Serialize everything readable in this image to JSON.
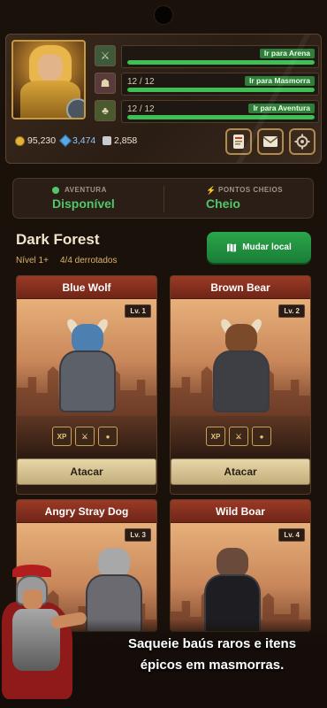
{
  "profile": {
    "quests": [
      {
        "icon": "arena-icon",
        "count": "",
        "link": "Ir para Arena",
        "fill": 1.0
      },
      {
        "icon": "dungeon-icon",
        "count": "12 / 12",
        "link": "Ir para Masmorra",
        "fill": 1.0
      },
      {
        "icon": "adventure-icon",
        "count": "12 / 12",
        "link": "Ir para Aventura",
        "fill": 1.0
      }
    ],
    "gold": "95,230",
    "gems": "3,474",
    "tokens": "2,858"
  },
  "status": {
    "adventure_label": "AVENTURA",
    "adventure_value": "Disponível",
    "points_label": "PONTOS CHEIOS",
    "points_value": "Cheio"
  },
  "location": {
    "title": "Dark Forest",
    "level": "Nível 1+",
    "defeated": "4/4 derrotados",
    "change_button": "Mudar local"
  },
  "enemies": [
    {
      "name": "Blue Wolf",
      "level": "Lv. 1",
      "attack": "Atacar",
      "rewards": [
        "XP",
        "",
        ""
      ]
    },
    {
      "name": "Brown Bear",
      "level": "Lv. 2",
      "attack": "Atacar",
      "rewards": [
        "XP",
        "",
        ""
      ]
    },
    {
      "name": "Angry Stray Dog",
      "level": "Lv. 3"
    },
    {
      "name": "Wild Boar",
      "level": "Lv. 4"
    }
  ],
  "promo": {
    "line1": "Saqueie baús raros e itens",
    "line2": "épicos em masmorras."
  },
  "colors": {
    "accent_green": "#2aa64a",
    "card_header": "#9b3a26",
    "gold": "#e3b23c"
  }
}
